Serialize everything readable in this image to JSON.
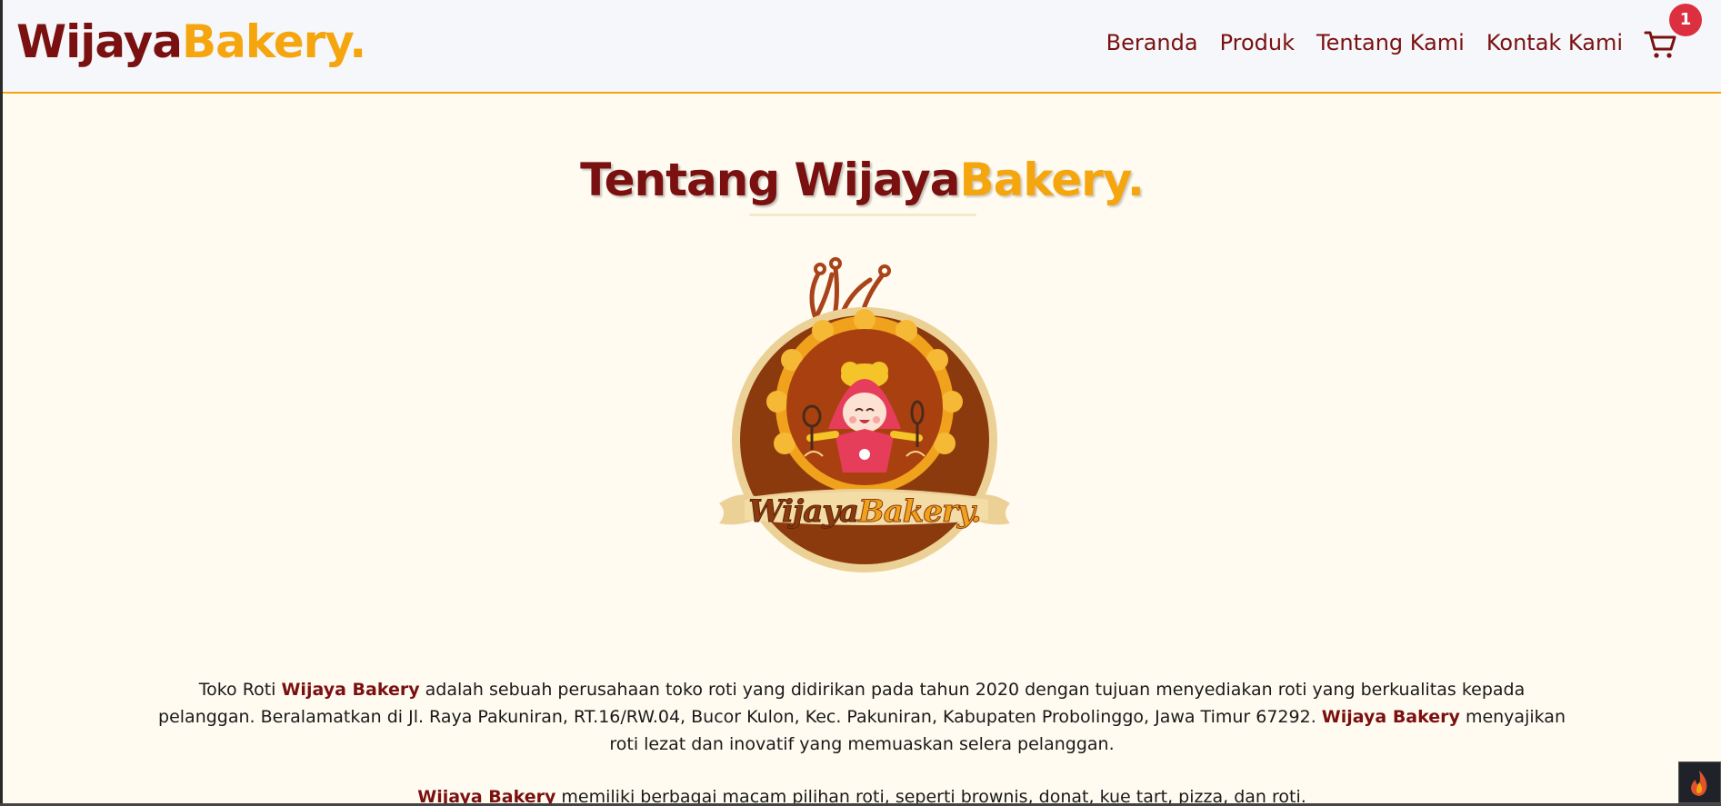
{
  "brand": {
    "name_part1": "Wijaya",
    "name_part2": "Bakery."
  },
  "nav": {
    "links": [
      "Beranda",
      "Produk",
      "Tentang Kami",
      "Kontak Kami"
    ],
    "cart_icon": "cart-icon",
    "cart_count": "1"
  },
  "page": {
    "title_part1": "Tentang Wijaya",
    "title_part2": "Bakery."
  },
  "logo": {
    "text_part1": "Wijaya",
    "text_part2": "Bakery."
  },
  "about": {
    "p1_text1": "Toko Roti ",
    "p1_bold1": "Wijaya Bakery",
    "p1_text2": " adalah sebuah perusahaan toko roti yang didirikan pada tahun 2020 dengan tujuan menyediakan roti yang berkualitas kepada pelanggan. Beralamatkan di Jl. Raya Pakuniran, RT.16/RW.04, Bucor Kulon, Kec. Pakuniran, Kabupaten Probolinggo, Jawa Timur 67292. ",
    "p1_bold2": "Wijaya Bakery",
    "p1_text3": " menyajikan roti lezat dan inovatif yang memuaskan selera pelanggan.",
    "p2_bold": "Wijaya Bakery",
    "p2_text": " memiliki berbagai macam pilihan roti, seperti brownis, donat, kue tart, pizza, dan roti."
  },
  "colors": {
    "maroon": "#7a1010",
    "gold": "#f5a50e",
    "page_bg": "#fffbf0",
    "nav_bg": "#f6f7fa",
    "badge": "#dc2f3f"
  },
  "fire_button": {
    "icon": "fire-icon"
  }
}
